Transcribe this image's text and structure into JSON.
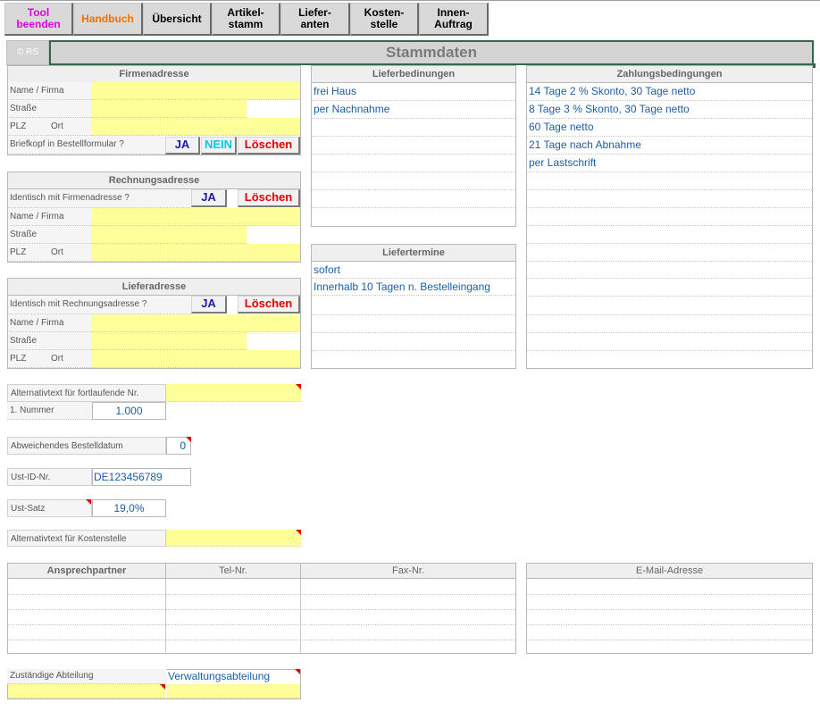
{
  "toolbar": {
    "tool_beenden": "Tool\nbeenden",
    "handbuch": "Handbuch",
    "uebersicht": "Übersicht",
    "artikelstamm": "Artikel-\nstamm",
    "lieferanten": "Liefer-\nanten",
    "kostenstelle": "Kosten-\nstelle",
    "innenauftrag": "Innen-\nAuftrag"
  },
  "copyright": "© RS",
  "page_title": "Stammdaten",
  "firmenadresse": {
    "header": "Firmenadresse",
    "name_label": "Name / Firma",
    "strasse_label": "Straße",
    "plz_label": "PLZ",
    "ort_label": "Ort",
    "briefkopf_label": "Briefkopf in Bestellformular ?",
    "ja": "JA",
    "nein": "NEIN",
    "loeschen": "Löschen"
  },
  "rechnungsadresse": {
    "header": "Rechnungsadresse",
    "identisch_label": "Identisch mit Firmenadresse ?",
    "ja": "JA",
    "loeschen": "Löschen",
    "name_label": "Name / Firma",
    "strasse_label": "Straße",
    "plz_label": "PLZ",
    "ort_label": "Ort"
  },
  "lieferadresse": {
    "header": "Lieferadresse",
    "identisch_label": "Identisch mit Rechnungsadresse ?",
    "ja": "JA",
    "loeschen": "Löschen",
    "name_label": "Name / Firma",
    "strasse_label": "Straße",
    "plz_label": "PLZ",
    "ort_label": "Ort"
  },
  "alternativtext_nr_label": "Alternativtext für fortlaufende Nr.",
  "erste_nummer_label": "1. Nummer",
  "erste_nummer_value": "1.000",
  "bestelldatum_label": "Abweichendes Bestelldatum",
  "bestelldatum_value": "0",
  "ust_id_label": "Ust-ID-Nr.",
  "ust_id_value": "DE123456789",
  "ust_satz_label": "Ust-Satz",
  "ust_satz_value": "19,0%",
  "alternativtext_kostenstelle_label": "Alternativtext für Kostenstelle",
  "lieferbedingungen": {
    "header": "Lieferbedinungen",
    "items": [
      "frei Haus",
      "per Nachnahme"
    ]
  },
  "liefertermine": {
    "header": "Liefertermine",
    "items": [
      "sofort",
      "Innerhalb 10 Tagen n. Bestelleingang"
    ]
  },
  "zahlungsbedingungen": {
    "header": "Zahlungsbedingungen",
    "items": [
      "14 Tage 2 % Skonto, 30 Tage netto",
      "8 Tage 3 % Skonto, 30 Tage netto",
      "60 Tage netto",
      "21 Tage nach Abnahme",
      "per Lastschrift"
    ]
  },
  "kontakte": {
    "ansprechpartner": "Ansprechpartner",
    "tel": "Tel-Nr.",
    "fax": "Fax-Nr.",
    "email": "E-Mail-Adresse"
  },
  "abteilung": {
    "label": "Zuständige  Abteilung",
    "value": "Verwaltungsabteilung"
  },
  "colors": {
    "yellow_input": "#ffff99",
    "link_blue": "#1a5fa8",
    "tool_magenta": "#e000e0",
    "handbuch_orange": "#f07000",
    "loeschen_red": "#e00000",
    "ja_blue": "#1a1aa8",
    "nein_cyan": "#00c8e0"
  }
}
